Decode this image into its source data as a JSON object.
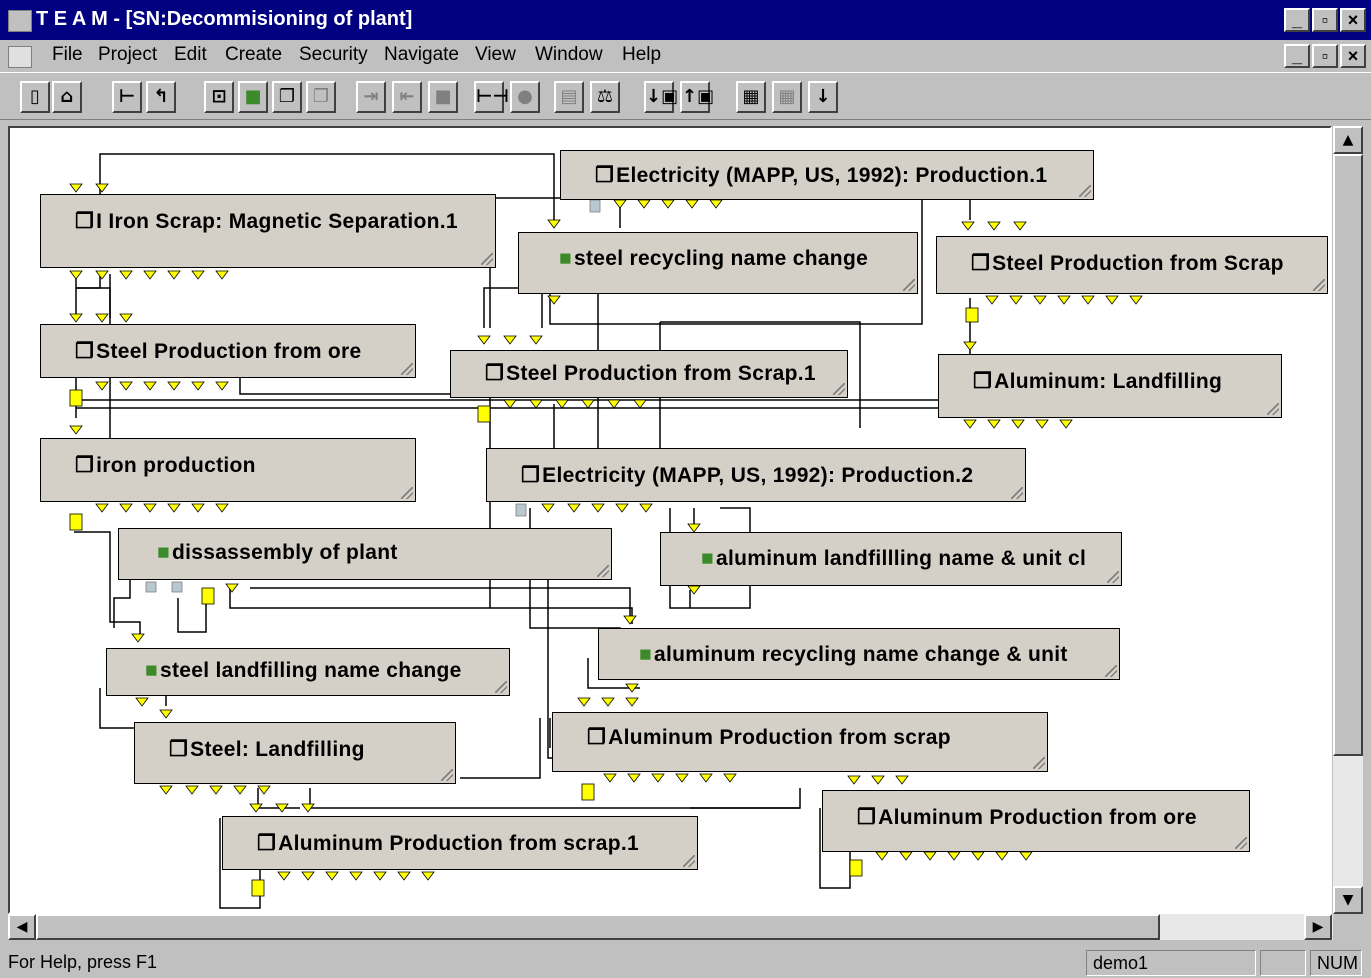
{
  "window": {
    "title": "T E A M - [SN:Decommisioning of plant]"
  },
  "menu": {
    "items": [
      "File",
      "Project",
      "Edit",
      "Create",
      "Security",
      "Navigate",
      "View",
      "Window",
      "Help"
    ]
  },
  "toolbar": {
    "buttons": [
      "new-icon",
      "open-icon",
      "tree-icon",
      "up-arrow-icon",
      "module-icon",
      "process-icon",
      "copy-process-icon",
      "copy-process-disabled-icon",
      "link-in-disabled-icon",
      "link-out-disabled-icon",
      "block-disabled-icon",
      "span-icon",
      "sphere-disabled-icon",
      "report-disabled-icon",
      "balance-icon",
      "lock-down-icon",
      "lock-up-icon",
      "chart-icon",
      "grid-disabled-icon",
      "arrow-down-icon"
    ]
  },
  "nodes": [
    {
      "label": "I Iron Scrap: Magnetic Separation.1",
      "kind": "process"
    },
    {
      "label": "Electricity (MAPP, US, 1992): Production.1",
      "kind": "process"
    },
    {
      "label": "steel recycling name change",
      "kind": "module"
    },
    {
      "label": "Steel Production from Scrap",
      "kind": "process"
    },
    {
      "label": "Steel Production from ore",
      "kind": "process"
    },
    {
      "label": "Steel Production from Scrap.1",
      "kind": "process"
    },
    {
      "label": "Aluminum: Landfilling",
      "kind": "process"
    },
    {
      "label": "iron production",
      "kind": "process"
    },
    {
      "label": "Electricity (MAPP, US, 1992): Production.2",
      "kind": "process"
    },
    {
      "label": "dissassembly of plant",
      "kind": "module"
    },
    {
      "label": "aluminum landfillling name & unit cl",
      "kind": "module"
    },
    {
      "label": "aluminum recycling name change & unit",
      "kind": "module"
    },
    {
      "label": "steel landfilling name change",
      "kind": "module"
    },
    {
      "label": "Aluminum Production from scrap",
      "kind": "process"
    },
    {
      "label": "Steel: Landfilling",
      "kind": "process"
    },
    {
      "label": "Aluminum Production from ore",
      "kind": "process"
    },
    {
      "label": "Aluminum Production from scrap.1",
      "kind": "process"
    }
  ],
  "status": {
    "help_text": "For Help, press F1",
    "user": "demo1",
    "indicator": "NUM"
  },
  "colors": {
    "title_bar": "#000080",
    "node_fill": "#d4d0c8",
    "arrow": "#000000",
    "port_yellow": "#ffff00",
    "module_icon": "#3c8a2a"
  }
}
